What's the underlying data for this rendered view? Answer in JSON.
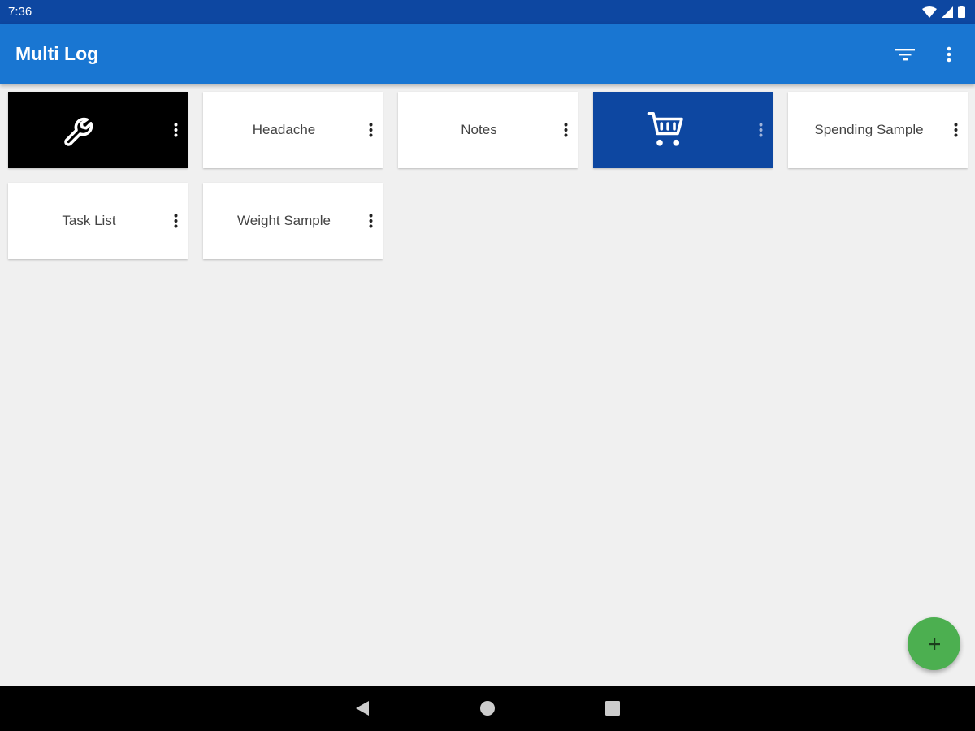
{
  "status_bar": {
    "time": "7:36"
  },
  "app_bar": {
    "title": "Multi Log"
  },
  "tiles": [
    {
      "label": "",
      "icon": "wrench-icon",
      "background": "#000000"
    },
    {
      "label": "Headache",
      "background": "#ffffff"
    },
    {
      "label": "Notes",
      "background": "#ffffff"
    },
    {
      "label": "",
      "icon": "cart-icon",
      "background": "#0d47a1"
    },
    {
      "label": "Spending Sample",
      "background": "#ffffff"
    },
    {
      "label": "Task List",
      "background": "#ffffff"
    },
    {
      "label": "Weight Sample",
      "background": "#ffffff"
    }
  ],
  "fab": {
    "label": "+",
    "color": "#4caf50"
  },
  "colors": {
    "status_bar": "#0d47a1",
    "app_bar": "#1976d2",
    "background": "#f0f0f0"
  }
}
